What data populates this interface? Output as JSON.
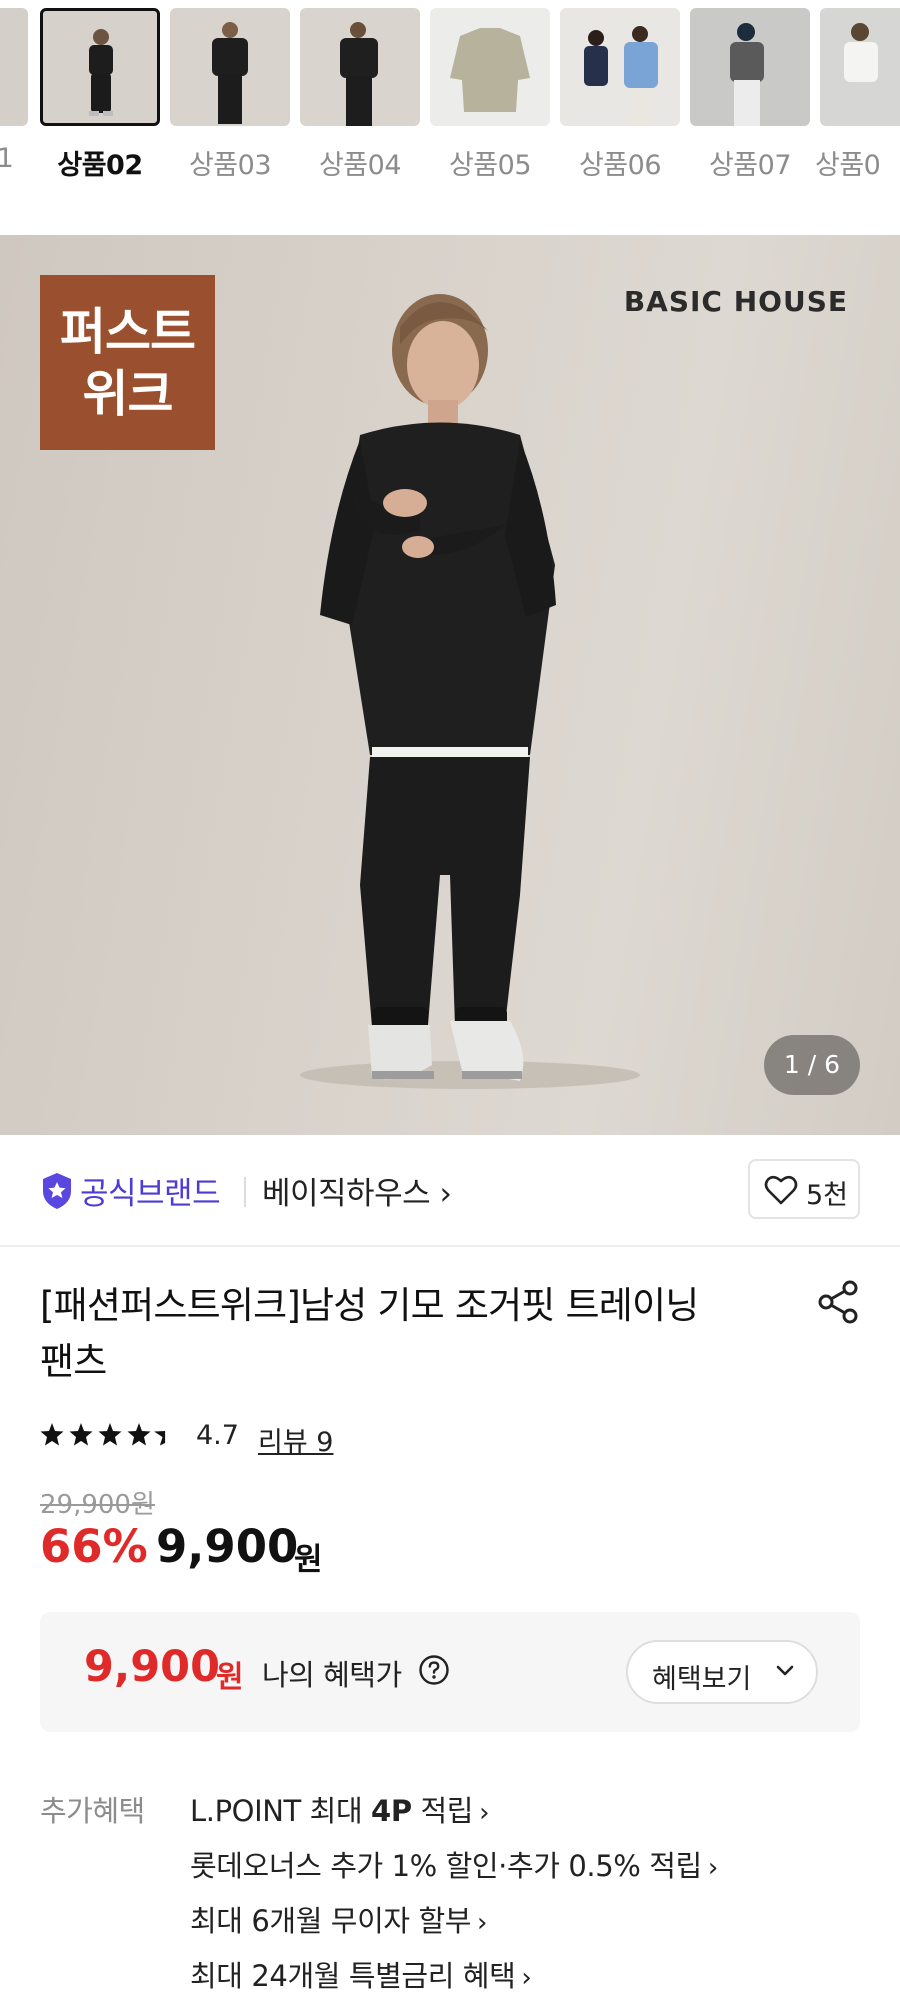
{
  "thumbnails": [
    {
      "label": "1",
      "active": false
    },
    {
      "label": "상품02",
      "active": true
    },
    {
      "label": "상품03",
      "active": false
    },
    {
      "label": "상품04",
      "active": false
    },
    {
      "label": "상품05",
      "active": false
    },
    {
      "label": "상품06",
      "active": false
    },
    {
      "label": "상품07",
      "active": false
    },
    {
      "label": "상품0",
      "active": false
    }
  ],
  "hero": {
    "badge_line1": "퍼스트",
    "badge_line2": "위크",
    "brand_mark": "BASIC HOUSE",
    "counter": "1 / 6"
  },
  "brand_row": {
    "official_label": "공식브랜드",
    "brand_name": "베이직하우스 ›",
    "wish_count": "5천"
  },
  "product": {
    "title_line1": "[패션퍼스트위크]남성 기모 조거핏 트레이닝",
    "title_line2": "팬츠",
    "rating": "4.7",
    "review_link": "리뷰 9",
    "original_price": "29,900원",
    "discount": "66%",
    "price": "9,900",
    "price_unit": "원"
  },
  "benefit_box": {
    "price": "9,900",
    "unit": "원",
    "label": "나의 혜택가",
    "button_label": "혜택보기"
  },
  "extra_benefits": {
    "title": "추가혜택",
    "items": [
      {
        "prefix": "L.POINT 최대 ",
        "bold": "4P",
        "suffix": " 적립"
      },
      {
        "prefix": "롯데오너스 추가 1% 할인·추가 0.5% 적립",
        "bold": "",
        "suffix": ""
      },
      {
        "prefix": "최대 6개월 무이자 할부",
        "bold": "",
        "suffix": ""
      },
      {
        "prefix": "최대 24개월 특별금리 혜택",
        "bold": "",
        "suffix": ""
      }
    ]
  },
  "colors": {
    "accent_red": "#e02a2a",
    "official_purple": "#4d3bd6",
    "badge_brown": "#9a4f2e"
  }
}
